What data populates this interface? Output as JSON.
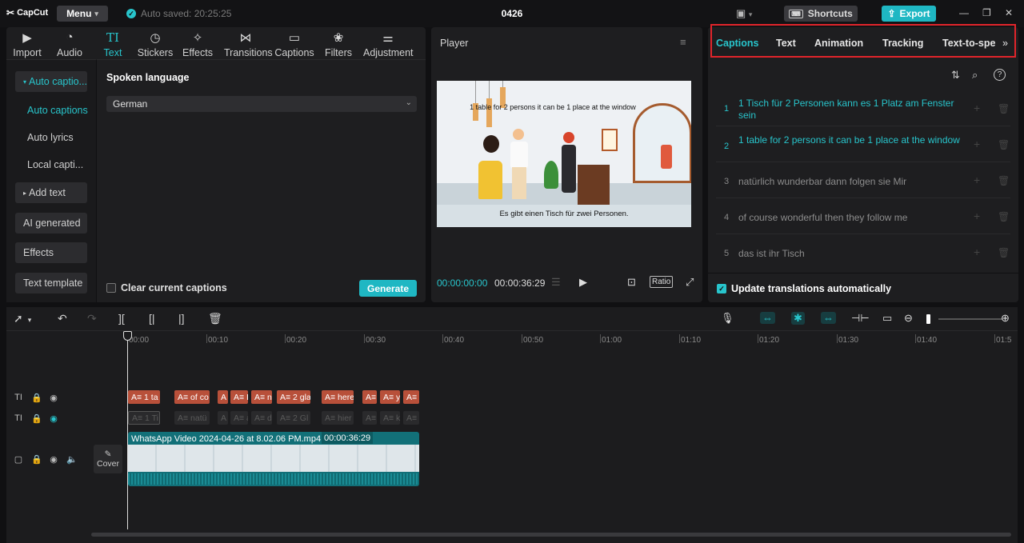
{
  "app": {
    "logo": "CapCut",
    "menu_label": "Menu",
    "autosave": "Auto saved: 20:25:25",
    "project_name": "0426",
    "shortcuts_label": "Shortcuts",
    "export_label": "Export",
    "accent_color": "#1fb7c3"
  },
  "toolbar": {
    "tabs": [
      {
        "label": "Import",
        "icon": "import-icon"
      },
      {
        "label": "Audio",
        "icon": "audio-icon"
      },
      {
        "label": "Text",
        "icon": "text-icon",
        "active": true
      },
      {
        "label": "Stickers",
        "icon": "stickers-icon"
      },
      {
        "label": "Effects",
        "icon": "effects-icon"
      },
      {
        "label": "Transitions",
        "icon": "transitions-icon"
      },
      {
        "label": "Captions",
        "icon": "captions-icon"
      },
      {
        "label": "Filters",
        "icon": "filters-icon"
      },
      {
        "label": "Adjustment",
        "icon": "adjustment-icon"
      }
    ]
  },
  "sidebar": {
    "auto_captions_group": "Auto captio...",
    "sub_items": [
      "Auto captions",
      "Auto lyrics",
      "Local capti..."
    ],
    "add_text": "Add text",
    "ai_generated": "AI generated",
    "effects": "Effects",
    "text_template": "Text template"
  },
  "captions_panel": {
    "spoken_language_label": "Spoken language",
    "language_value": "German",
    "clear_captions_label": "Clear current captions",
    "generate_label": "Generate"
  },
  "player": {
    "title": "Player",
    "current_time": "00:00:00:00",
    "total_time": "00:00:36:29",
    "ratio_label": "Ratio",
    "frame_subtitle_top": "1 table for 2 persons it can be 1 place at the window",
    "frame_subtitle_bottom": "Es gibt einen Tisch für zwei Personen."
  },
  "right_panel": {
    "tabs": [
      "Captions",
      "Text",
      "Animation",
      "Tracking",
      "Text-to-spe"
    ],
    "active_tab": "Captions",
    "captions": [
      {
        "num": "1",
        "text": "1 Tisch für 2 Personen kann es 1 Platz am Fenster sein",
        "active": true
      },
      {
        "num": "2",
        "text": "1 table for 2 persons it can be 1 place at the window",
        "active": true
      },
      {
        "num": "3",
        "text": "natürlich wunderbar dann folgen sie Mir",
        "active": false
      },
      {
        "num": "4",
        "text": "of course wonderful then they follow me",
        "active": false
      },
      {
        "num": "5",
        "text": "das ist ihr Tisch",
        "active": false
      }
    ],
    "update_label": "Update translations automatically"
  },
  "timeline": {
    "ticks": [
      "00:00",
      "00:10",
      "00:20",
      "00:30",
      "00:40",
      "00:50",
      "01:00",
      "01:10",
      "01:20",
      "01:30",
      "01:40",
      "01:5"
    ],
    "track1_clips": [
      "A≡ 1 ta",
      "A≡ of co",
      "A",
      "A≡ I",
      "A≡ n",
      "A≡ 2 gla",
      "A≡ here",
      "A≡",
      "A≡ y",
      "A≡"
    ],
    "track2_clips": [
      "A≡ 1 Ti",
      "A≡ natü",
      "A",
      "A≡ a",
      "A≡ d",
      "A≡ 2 Gl",
      "A≡ hier",
      "A≡",
      "A≡ k",
      "A≡"
    ],
    "video_clip_title": "WhatsApp Video 2024-04-26 at 8.02.06 PM.mp4",
    "video_clip_duration": "00:00:36:29",
    "cover_label": "Cover"
  }
}
